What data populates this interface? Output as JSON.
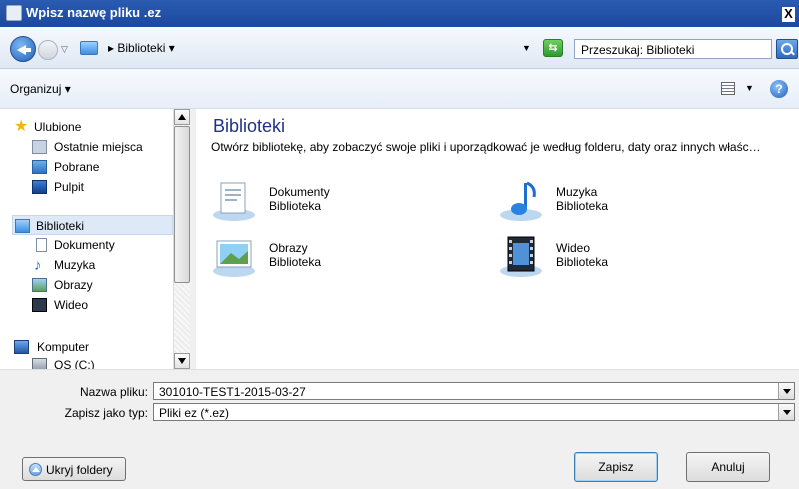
{
  "window": {
    "title": "Wpisz nazwę pliku .ez",
    "close_label": "X"
  },
  "address": {
    "breadcrumb": "Biblioteki",
    "search_placeholder": "Przeszukaj: Biblioteki"
  },
  "toolbar": {
    "organize_label": "Organizuj"
  },
  "sidebar": {
    "items": [
      {
        "label": "Ulubione"
      },
      {
        "label": "Ostatnie miejsca"
      },
      {
        "label": "Pobrane"
      },
      {
        "label": "Pulpit"
      },
      {
        "label": "Biblioteki"
      },
      {
        "label": "Dokumenty"
      },
      {
        "label": "Muzyka"
      },
      {
        "label": "Obrazy"
      },
      {
        "label": "Wideo"
      },
      {
        "label": "Komputer"
      },
      {
        "label": "OS (C:)"
      }
    ],
    "selected": "Biblioteki"
  },
  "main": {
    "heading": "Biblioteki",
    "description": "Otwórz bibliotekę, aby zobaczyć swoje pliki i uporządkować je według folderu, daty oraz innych właśc…",
    "libraries": [
      {
        "name": "Dokumenty",
        "type": "Biblioteka",
        "icon": "documents-library-icon"
      },
      {
        "name": "Muzyka",
        "type": "Biblioteka",
        "icon": "music-library-icon"
      },
      {
        "name": "Obrazy",
        "type": "Biblioteka",
        "icon": "pictures-library-icon"
      },
      {
        "name": "Wideo",
        "type": "Biblioteka",
        "icon": "video-library-icon"
      }
    ]
  },
  "form": {
    "filename_label": "Nazwa pliku:",
    "filename_value": "301010-TEST1-2015-03-27",
    "filetype_label": "Zapisz jako typ:",
    "filetype_value": "Pliki ez (*.ez)"
  },
  "buttons": {
    "hide_folders": "Ukryj foldery",
    "save": "Zapisz",
    "cancel": "Anuluj"
  }
}
